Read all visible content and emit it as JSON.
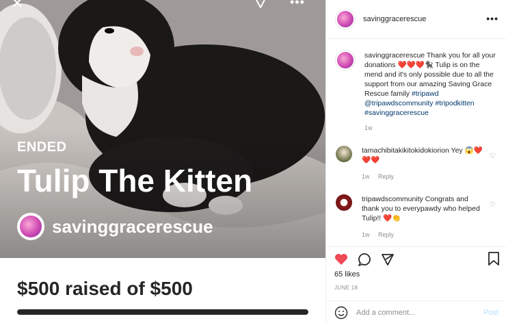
{
  "media": {
    "status": "ENDED",
    "title": "Tulip The Kitten",
    "organizer": "savinggracerescue",
    "raised_text": "$500 raised of $500",
    "progress_fraction": 1.0
  },
  "header": {
    "username": "savinggracerescue",
    "more": "•••"
  },
  "caption": {
    "username": "savinggracerescue",
    "text_1": "Thank you for all your donations",
    "emojis_1": "❤️❤️❤️🐈‍⬛",
    "text_2": "Tulip is on the mend and it's only possible due to all the support from our amazing Saving Grace Rescue family",
    "tags": "#tripawd @tripawdscommunity #tripodkitten #savinggracerescue",
    "time": "1w"
  },
  "comments": [
    {
      "username": "tamachibitakikitokidokiorion",
      "text": "Yey",
      "emojis": "😱❤️❤️❤️",
      "time": "1w",
      "reply": "Reply"
    },
    {
      "username": "tripawdscommunity",
      "text": "Congrats and thank you to everypawdy who helped Tulip!!",
      "emojis": "❤️👏",
      "time": "1w",
      "reply": "Reply"
    }
  ],
  "actions": {
    "likes": "65 likes",
    "date": "JUNE 18",
    "comment_placeholder": "Add a comment...",
    "post_label": "Post"
  },
  "colors": {
    "like_red": "#ed4956",
    "link_blue": "#00376b",
    "post_blue": "#b2dffc"
  }
}
